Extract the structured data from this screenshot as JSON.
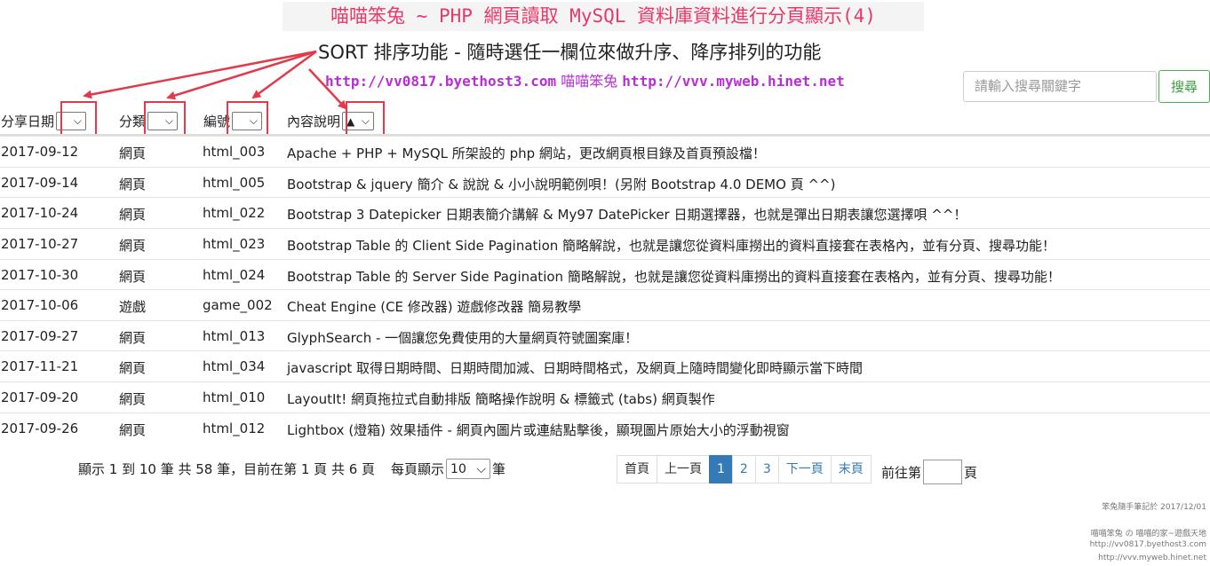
{
  "title": "喵喵笨兔 ~ PHP 網頁讀取 MySQL 資料庫資料進行分頁顯示(4)",
  "annotation": "SORT 排序功能 - 隨時選任一欄位來做升序、降序排列的功能",
  "links": {
    "site1": "http://vv0817.byethost3.com",
    "name": "喵喵笨兔",
    "site2": "http://vvv.myweb.hinet.net"
  },
  "search": {
    "placeholder": "請輸入搜尋關鍵字",
    "button": "搜尋"
  },
  "columns": [
    {
      "label": "分享日期",
      "sort": ""
    },
    {
      "label": "分類",
      "sort": ""
    },
    {
      "label": "編號",
      "sort": ""
    },
    {
      "label": "內容說明",
      "sort": "▲"
    }
  ],
  "rows": [
    {
      "date": "2017-09-12",
      "category": "網頁",
      "id": "html_003",
      "desc": "Apache + PHP + MySQL 所架設的 php 網站，更改網頁根目錄及首頁預設檔！"
    },
    {
      "date": "2017-09-14",
      "category": "網頁",
      "id": "html_005",
      "desc": "Bootstrap & jquery 簡介 & 說說 & 小小說明範例唄！(另附 Bootstrap 4.0 DEMO 頁 ^^)"
    },
    {
      "date": "2017-10-24",
      "category": "網頁",
      "id": "html_022",
      "desc": "Bootstrap 3 Datepicker 日期表簡介講解 & My97 DatePicker 日期選擇器，也就是彈出日期表讓您選擇唄 ^^！"
    },
    {
      "date": "2017-10-27",
      "category": "網頁",
      "id": "html_023",
      "desc": "Bootstrap Table 的 Client Side Pagination 簡略解說，也就是讓您從資料庫撈出的資料直接套在表格內，並有分頁、搜尋功能！"
    },
    {
      "date": "2017-10-30",
      "category": "網頁",
      "id": "html_024",
      "desc": "Bootstrap Table 的 Server Side Pagination 簡略解說，也就是讓您從資料庫撈出的資料直接套在表格內，並有分頁、搜尋功能！"
    },
    {
      "date": "2017-10-06",
      "category": "遊戲",
      "id": "game_002",
      "desc": "Cheat Engine (CE 修改器) 遊戲修改器 簡易教學"
    },
    {
      "date": "2017-09-27",
      "category": "網頁",
      "id": "html_013",
      "desc": "GlyphSearch - 一個讓您免費使用的大量網頁符號圖案庫！"
    },
    {
      "date": "2017-11-21",
      "category": "網頁",
      "id": "html_034",
      "desc": "javascript 取得日期時間、日期時間加減、日期時間格式，及網頁上隨時間變化即時顯示當下時間"
    },
    {
      "date": "2017-09-20",
      "category": "網頁",
      "id": "html_010",
      "desc": "LayoutIt! 網頁拖拉式自動排版 簡略操作說明 & 標籤式 (tabs) 網頁製作"
    },
    {
      "date": "2017-09-26",
      "category": "網頁",
      "id": "html_012",
      "desc": "Lightbox (燈箱) 效果插件 - 網頁內圖片或連結點擊後，顯現圖片原始大小的浮動視窗"
    }
  ],
  "info": {
    "text": "顯示 1 到 10 筆 共 58 筆，目前在第 1 頁 共 6 頁",
    "per_page_label": "每頁顯示",
    "per_page": "10",
    "unit": "筆"
  },
  "pager": {
    "first": "首頁",
    "prev": "上一頁",
    "pages": [
      "1",
      "2",
      "3"
    ],
    "current": "1",
    "next": "下一頁",
    "last": "末頁"
  },
  "goto": {
    "prefix": "前往第",
    "suffix": "頁"
  },
  "footer": {
    "note": "笨兔隨手筆記於 2017/12/01",
    "line1": "喵喵笨兔 の 喵喵的家~遊戲天地",
    "line2": "http://vv0817.byethost3.com",
    "line3": "http://vvv.myweb.hinet.net"
  },
  "colors": {
    "title": "#e8386a",
    "links": "#b92dd6",
    "annotation_red": "#e23a4a",
    "pager_active": "#337ab7",
    "search_green": "#4cae4c"
  }
}
